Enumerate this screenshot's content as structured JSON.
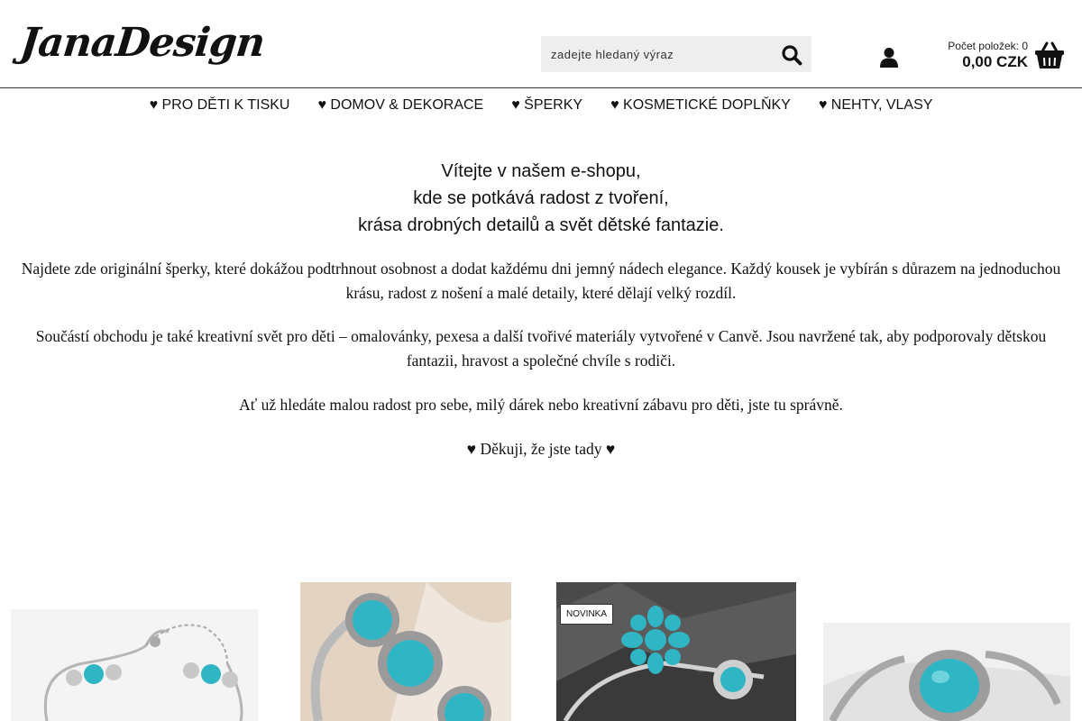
{
  "header": {
    "logo_text": "JanaDesign",
    "search_placeholder": "zadejte hledaný výraz",
    "cart_count_label": "Počet položek: 0",
    "cart_total": "0,00 CZK"
  },
  "nav": {
    "items": [
      {
        "label": "♥ PRO DĚTI K TISKU"
      },
      {
        "label": "♥ DOMOV & DEKORACE"
      },
      {
        "label": "♥ ŠPERKY"
      },
      {
        "label": "♥ KOSMETICKÉ DOPLŇKY"
      },
      {
        "label": "♥ NEHTY, VLASY"
      }
    ]
  },
  "intro": {
    "line1": "Vítejte v našem e-shopu,",
    "line2": "kde se potkává radost z tvoření,",
    "line3": "krása drobných detailů a svět dětské fantazie."
  },
  "paragraphs": {
    "p1": "Najdete zde originální šperky, které dokážou podtrhnout osobnost a dodat každému dni jemný nádech elegance. Každý kousek je vybírán  s důrazem na jednoduchou krásu, radost z nošení a malé detaily, které dělají velký rozdíl.",
    "p2": "Součástí obchodu je také kreativní svět pro děti – omalovánky, pexesa a další tvořivé materiály vytvořené v Canvě. Jsou navržené tak, aby podporovaly dětskou fantazii, hravost a společné chvíle s rodiči.",
    "p3": "Ať už hledáte malou radost pro sebe, milý dárek nebo kreativní zábavu pro děti, jste tu správně.",
    "p4": "♥ Děkuji, že jste tady ♥"
  },
  "products": {
    "badge_new": "NOVINKA"
  },
  "colors": {
    "turquoise": "#2fb5c4",
    "silver": "#c8c8c8",
    "search_bg": "#eeeeee"
  }
}
